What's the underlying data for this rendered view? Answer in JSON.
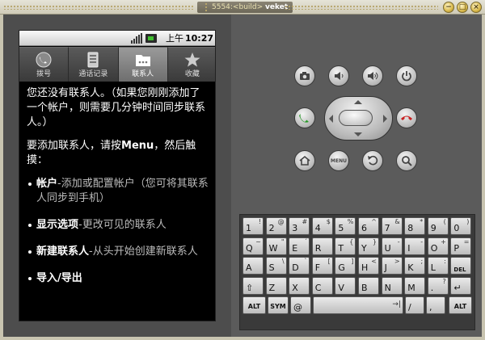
{
  "window": {
    "title_port": "5554:<build>",
    "title_avd": "veket",
    "buttons": [
      "−",
      "□",
      "×"
    ]
  },
  "statusbar": {
    "ampm": "上午",
    "time": "10:27"
  },
  "tabs": [
    {
      "label": "拨号",
      "icon": "phone-icon",
      "active": false
    },
    {
      "label": "通话记录",
      "icon": "call-log-icon",
      "active": false
    },
    {
      "label": "联系人",
      "icon": "contacts-icon",
      "active": true
    },
    {
      "label": "收藏",
      "icon": "star-icon",
      "active": false
    }
  ],
  "content": {
    "intro": "您还没有联系人。（如果您刚刚添加了一个帐户，则需要几分钟时间同步联系人。）",
    "add_prefix": "要添加联系人，请按",
    "add_menu": "Menu",
    "add_suffix": "，然后触摸：",
    "items": [
      {
        "title": "帐户",
        "desc": "-添加或配置帐户（您可将其联系人同步到手机）"
      },
      {
        "title": "显示选项",
        "desc": "-更改可见的联系人"
      },
      {
        "title": "新建联系人",
        "desc": "-从头开始创建新联系人"
      },
      {
        "title": "导入/导出",
        "desc": ""
      }
    ]
  },
  "controls": {
    "top_row": [
      "camera-icon",
      "volume-down-icon",
      "volume-up-icon",
      "power-icon"
    ],
    "call": "call-icon",
    "end_call": "end-call-icon",
    "bottom_row": [
      "home-icon",
      "menu-button",
      "back-icon",
      "search-icon"
    ],
    "menu_label": "MENU"
  },
  "keyboard": {
    "row1": [
      [
        "1",
        "!"
      ],
      [
        "2",
        "@"
      ],
      [
        "3",
        "#"
      ],
      [
        "4",
        "$"
      ],
      [
        "5",
        "%"
      ],
      [
        "6",
        "^"
      ],
      [
        "7",
        "&"
      ],
      [
        "8",
        "*"
      ],
      [
        "9",
        "("
      ],
      [
        "0",
        ")"
      ]
    ],
    "row2": [
      [
        "Q",
        "~"
      ],
      [
        "W",
        "\""
      ],
      [
        "E",
        "´"
      ],
      [
        "R",
        ""
      ],
      [
        "T",
        "{"
      ],
      [
        "Y",
        "}"
      ],
      [
        "U",
        "-"
      ],
      [
        "I",
        "-"
      ],
      [
        "O",
        "+"
      ],
      [
        "P",
        "="
      ]
    ],
    "row3": [
      [
        "A",
        ""
      ],
      [
        "S",
        "\\"
      ],
      [
        "D",
        "`"
      ],
      [
        "F",
        "["
      ],
      [
        "G",
        "]"
      ],
      [
        "H",
        "<"
      ],
      [
        "J",
        ">"
      ],
      [
        "K",
        ";"
      ],
      [
        "L",
        ":"
      ],
      [
        "DEL",
        ""
      ]
    ],
    "row4": [
      [
        "⇧",
        ""
      ],
      [
        "Z",
        ""
      ],
      [
        "X",
        ""
      ],
      [
        "C",
        ""
      ],
      [
        "V",
        ""
      ],
      [
        "B",
        ""
      ],
      [
        "N",
        ""
      ],
      [
        "M",
        ""
      ],
      [
        ".",
        "?"
      ],
      [
        "↵",
        ""
      ]
    ],
    "row5_labels": {
      "alt": "ALT",
      "sym": "SYM",
      "at": "@",
      "slash": "/",
      "comma": ",",
      "tab": "→|"
    }
  }
}
